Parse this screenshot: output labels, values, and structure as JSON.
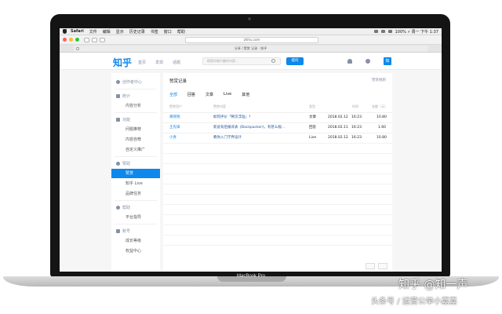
{
  "device": {
    "base_label": "MacBook Pro"
  },
  "menubar": {
    "items": [
      "Safari",
      "文件",
      "编辑",
      "显示",
      "历史记录",
      "书签",
      "窗口",
      "帮助"
    ],
    "status": "100% ⚡ 周一 下午 1:37"
  },
  "browser": {
    "address": "zhihu.com",
    "tab_title": "分享 / 赞赏 记录 - 知乎"
  },
  "header": {
    "logo": "知乎",
    "nav": [
      "首页",
      "发现",
      "话题"
    ],
    "search_placeholder": "搜索你感兴趣的内容...",
    "ask_button": "提问",
    "avatar_text": "知"
  },
  "sidebar": {
    "creator_center": "创作者中心",
    "stats": {
      "title": "统计",
      "items": [
        "内容分析"
      ]
    },
    "features": {
      "title": "功能",
      "items": [
        "问题推荐",
        "内容自荐",
        "自定义推广"
      ]
    },
    "earnings": {
      "title": "赞助",
      "items": [
        "赞赏",
        "知乎 Live",
        "品牌任务"
      ]
    },
    "help": {
      "title": "帮助",
      "items": [
        "平台指导"
      ]
    },
    "account": {
      "title": "账号",
      "items": [
        "成长等级",
        "权益中心"
      ]
    }
  },
  "main": {
    "title": "赞赏记录",
    "top_link": "赞赏规则",
    "tabs": [
      "全部",
      "回答",
      "文章",
      "Live",
      "其他"
    ],
    "columns": [
      "赞赏用户",
      "赞赏内容",
      "类型",
      "时间",
      "金额（元）"
    ],
    "rows": [
      {
        "user": "黄晓晓",
        "content": "如何评价「稀页浮准」?",
        "type": "文章",
        "date": "2018.02.12",
        "time": "16:23",
        "amount": "10.80"
      },
      {
        "user": "王先锋",
        "content": "新此背后报背表《Backpacker》，有甚么规...",
        "type": "回答",
        "date": "2018.02.11",
        "time": "16:23",
        "amount": "1.60"
      },
      {
        "user": "小青",
        "content": "教你入门学界设计",
        "type": "Live",
        "date": "2018.02.12",
        "time": "16:23",
        "amount": "10.80"
      }
    ]
  },
  "watermark": {
    "line1": "知乎 @知一声",
    "line2": "头条号 / 运营公举小嘉嘉"
  }
}
